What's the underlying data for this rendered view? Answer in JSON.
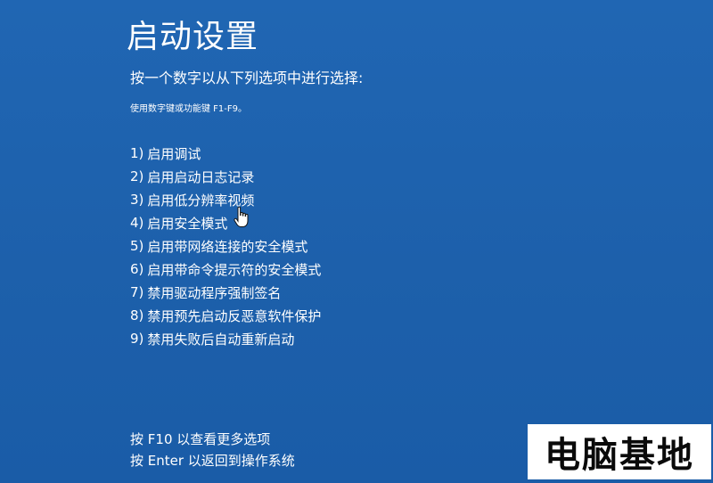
{
  "screen": {
    "title": "启动设置",
    "subtitle": "按一个数字以从下列选项中进行选择:",
    "hint": "使用数字键或功能键 F1-F9。",
    "background_color": "#1e62ad"
  },
  "options": [
    {
      "num": "1)",
      "label": "启用调试"
    },
    {
      "num": "2)",
      "label": "启用启动日志记录"
    },
    {
      "num": "3)",
      "label": "启用低分辨率视频"
    },
    {
      "num": "4)",
      "label": "启用安全模式"
    },
    {
      "num": "5)",
      "label": "启用带网络连接的安全模式"
    },
    {
      "num": "6)",
      "label": "启用带命令提示符的安全模式"
    },
    {
      "num": "7)",
      "label": "禁用驱动程序强制签名"
    },
    {
      "num": "8)",
      "label": "禁用预先启动反恶意软件保护"
    },
    {
      "num": "9)",
      "label": "禁用失败后自动重新启动"
    }
  ],
  "footer": {
    "more_options": "按 F10 以查看更多选项",
    "return_os": "按 Enter 以返回到操作系统"
  },
  "cursor": {
    "icon": "hand-pointer-icon"
  },
  "watermark": {
    "text": "电脑基地"
  }
}
